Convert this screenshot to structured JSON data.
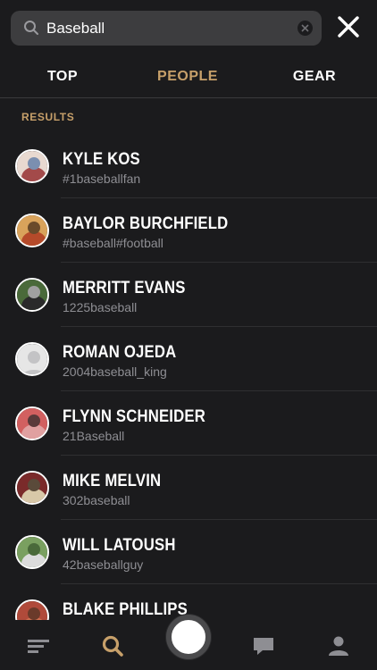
{
  "search": {
    "value": "Baseball"
  },
  "tabs": [
    {
      "label": "TOP",
      "active": false
    },
    {
      "label": "PEOPLE",
      "active": true
    },
    {
      "label": "GEAR",
      "active": false
    }
  ],
  "results_label": "RESULTS",
  "results": [
    {
      "name": "KYLE KOS",
      "handle": "#1baseballfan",
      "avatar_colors": [
        "#e8d9d0",
        "#a34a4a",
        "#7b8fb0"
      ]
    },
    {
      "name": "BAYLOR BURCHFIELD",
      "handle": "#baseball#football",
      "avatar_colors": [
        "#d9a35b",
        "#b54a2a",
        "#6a4a2a"
      ]
    },
    {
      "name": "MERRITT EVANS",
      "handle": "1225baseball",
      "avatar_colors": [
        "#4a6a3a",
        "#2a2a2a",
        "#a0a0a0"
      ]
    },
    {
      "name": "ROMAN OJEDA",
      "handle": "2004baseball_king",
      "avatar_colors": [
        "#e5e5e5",
        "#c7c7c9",
        "#c7c7c9"
      ]
    },
    {
      "name": "FLYNN SCHNEIDER",
      "handle": "21Baseball",
      "avatar_colors": [
        "#d26060",
        "#e0a0a0",
        "#5a3a3a"
      ]
    },
    {
      "name": "MIKE MELVIN",
      "handle": "302baseball",
      "avatar_colors": [
        "#7a2a2a",
        "#d8c8a8",
        "#5a4a3a"
      ]
    },
    {
      "name": "WILL LATOUSH",
      "handle": "42baseballguy",
      "avatar_colors": [
        "#7aa060",
        "#dcdcdc",
        "#4a6a3a"
      ]
    },
    {
      "name": "BLAKE PHILLIPS",
      "handle": "",
      "avatar_colors": [
        "#b04a3a",
        "#d07050",
        "#6a3a2a"
      ]
    }
  ],
  "colors": {
    "accent": "#c7a06a",
    "background": "#1b1b1d",
    "muted": "#8e8e93"
  },
  "bottom_nav": [
    {
      "icon": "feed-icon",
      "active": false
    },
    {
      "icon": "search-icon",
      "active": true
    },
    {
      "icon": "capture-button",
      "active": false
    },
    {
      "icon": "messages-icon",
      "active": false
    },
    {
      "icon": "profile-icon",
      "active": false
    }
  ]
}
